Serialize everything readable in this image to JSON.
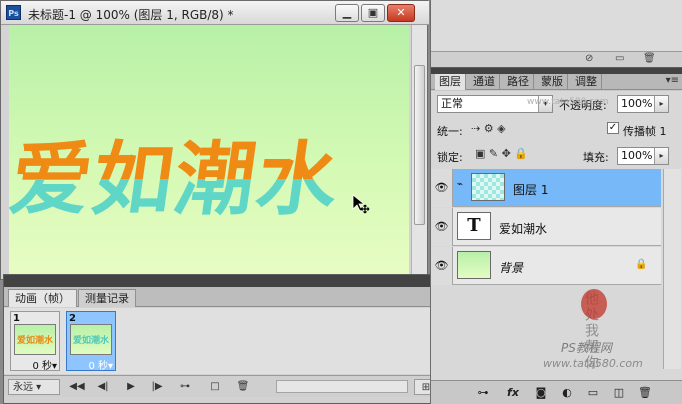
{
  "document": {
    "title": "未标题-1 @ 100% (图层 1, RGB/8) *",
    "ps_badge": "Ps",
    "canvas_text": "爱如潮水",
    "minimize": "▁",
    "restore": "▣",
    "close": "✕"
  },
  "animation": {
    "tabs": [
      "动画（帧）",
      "测量记录"
    ],
    "frames": [
      {
        "num": "1",
        "thumb_text": "爱如潮水",
        "delay": "0 秒▾",
        "selected": false
      },
      {
        "num": "2",
        "thumb_text": "爱如潮水",
        "delay": "0 秒▾",
        "selected": true
      }
    ],
    "loop": "永远",
    "controls": [
      "◀◀",
      "◀|",
      "▶",
      "|▶",
      "⊶",
      "□",
      "🗑"
    ]
  },
  "layers_panel": {
    "tabs": [
      "图层",
      "通道",
      "路径",
      "蒙版",
      "调整"
    ],
    "blend_mode": "正常",
    "opacity_label": "不透明度:",
    "opacity_value": "100%",
    "unify_label": "统一:",
    "propagate_label": "传播帧 1",
    "lock_label": "锁定:",
    "fill_label": "填充:",
    "fill_value": "100%",
    "layers": [
      {
        "name": "图层 1",
        "selected": true,
        "kind": "pixel"
      },
      {
        "name": "爱如潮水",
        "selected": false,
        "kind": "text"
      },
      {
        "name": "背景",
        "selected": false,
        "kind": "background"
      }
    ],
    "footer_buttons": [
      "⊶",
      "fx",
      "◙",
      "◐",
      "▭",
      "◫",
      "🗑"
    ]
  },
  "watermark": {
    "site": "www.tata580.com",
    "brand": "PS教程网",
    "calligraphy": "他处我帮你"
  }
}
